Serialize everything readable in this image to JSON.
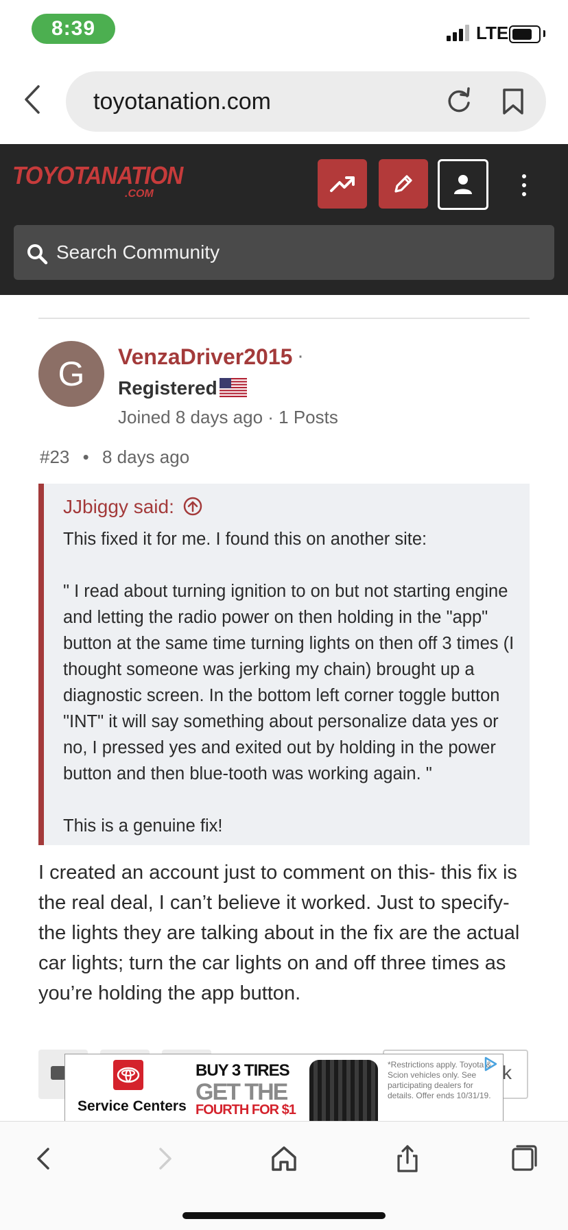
{
  "status_bar": {
    "time": "8:39",
    "network": "LTE"
  },
  "browser": {
    "url": "toyotanation.com"
  },
  "site": {
    "logo_main": "TOYOTANATION",
    "logo_sub": ".COM",
    "search_placeholder": "Search Community"
  },
  "post": {
    "avatar_letter": "G",
    "author": "VenzaDriver2015",
    "author_separator": "·",
    "role": "Registered",
    "joined": "Joined 8 days ago · 1 Posts",
    "number": "#23",
    "meta_separator": "•",
    "time_ago": "8 days ago",
    "quote": {
      "attribution": "JJbiggy said:",
      "text": "This fixed it for me. I found this on another site:\n\n\" I read about turning ignition to on but not starting engine and letting the radio power on then holding in the \"app\" button at the same time turning lights on then off 3 times (I thought someone was jerking my chain) brought up a diagnostic screen. In the bottom left corner toggle button \"INT\" it will say something about personalize data yes or no, I pressed yes and exited out by holding in the power button and then blue-tooth was working again. \"\n\nThis is a genuine fix!"
    },
    "body": "I created an account just to comment on this- this fix is the real deal, I can’t believe it worked. Just to specify-the lights they are talking about in the fix are the actual car lights; turn the car lights on and off three times as you’re holding the app button.",
    "reaction_right_partial": "k"
  },
  "ad": {
    "brand_label": "Service Centers",
    "headline_1": "BUY 3 TIRES",
    "headline_2": "GET THE",
    "headline_3": "FOURTH FOR $1",
    "fine_print": "*Restrictions apply. Toyota & Scion vehicles only. See participating dealers for details. Offer ends 10/31/19."
  },
  "colors": {
    "brand_red": "#a33a3a",
    "header_bg": "#262626",
    "time_pill": "#4caf50"
  },
  "icons": [
    "chevron-left-icon",
    "reload-icon",
    "bookmark-icon",
    "trending-icon",
    "pencil-icon",
    "person-icon",
    "more-vertical-icon",
    "search-icon",
    "us-flag-icon",
    "arrow-up-circle-icon",
    "adchoices-icon",
    "back-icon",
    "forward-icon",
    "home-icon",
    "share-icon",
    "tabs-icon"
  ]
}
